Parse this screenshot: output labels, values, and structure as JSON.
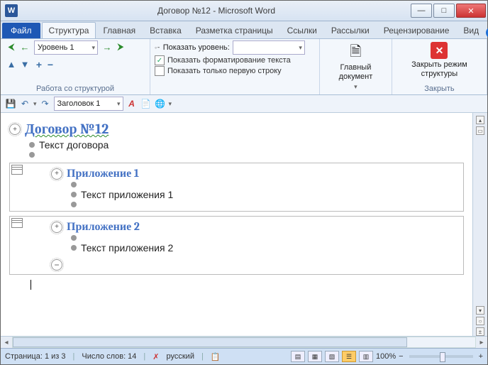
{
  "window": {
    "title": "Договор №12  -  Microsoft Word",
    "app_letter": "W"
  },
  "tabs": {
    "file": "Файл",
    "structure": "Структура",
    "home": "Главная",
    "insert": "Вставка",
    "layout": "Разметка страницы",
    "refs": "Ссылки",
    "mail": "Рассылки",
    "review": "Рецензирование",
    "view": "Вид"
  },
  "ribbon": {
    "level_value": "Уровень 1",
    "show_level_label": "Показать уровень:",
    "show_formatting": "Показать форматирование текста",
    "show_first_line": "Показать только первую строку",
    "tools_label": "Работа со структурой",
    "main_doc": "Главный документ",
    "close_outline": "Закрыть режим структуры",
    "close_group": "Закрыть"
  },
  "qat": {
    "style_value": "Заголовок 1"
  },
  "outline": {
    "h1": "Договор №12",
    "body1": "Текст договора",
    "sub1_title": "Приложение 1",
    "sub1_body": "Текст приложения  1",
    "sub2_title": "Приложение 2",
    "sub2_body": "Текст приложения 2"
  },
  "status": {
    "page": "Страница: 1 из 3",
    "words": "Число слов: 14",
    "lang": "русский",
    "zoom": "100%"
  }
}
